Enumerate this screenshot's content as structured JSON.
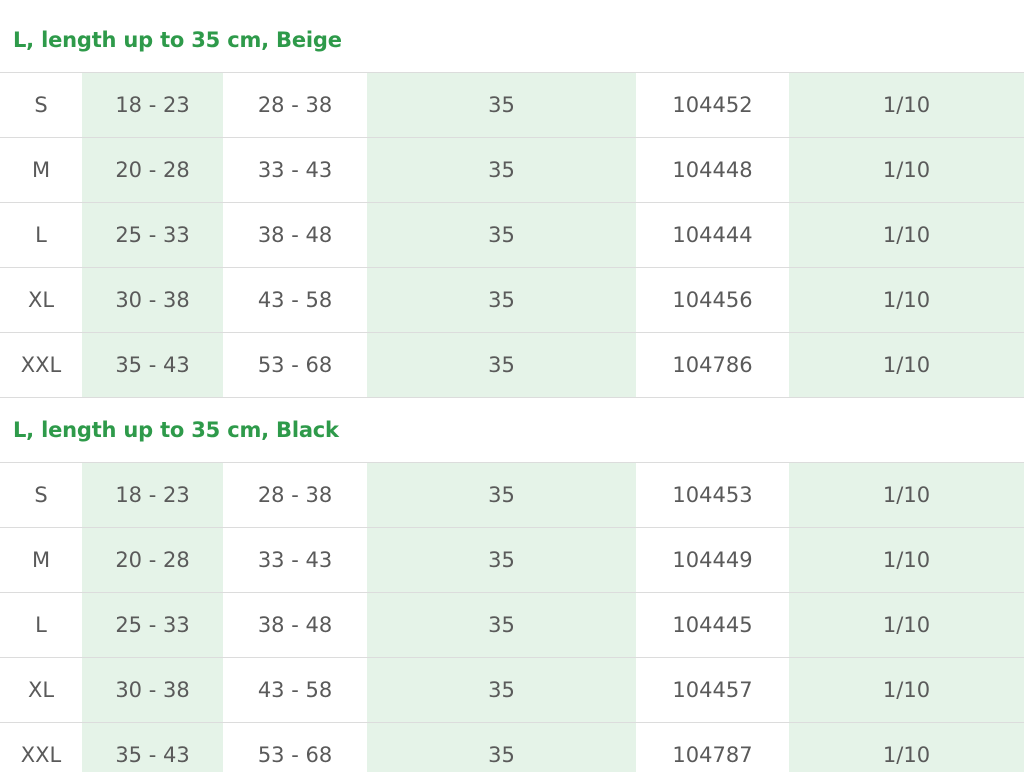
{
  "groups": [
    {
      "title": "L, length up to 35 cm, Beige",
      "rows": [
        [
          "S",
          "18 - 23",
          "28 - 38",
          "35",
          "104452",
          "1/10"
        ],
        [
          "M",
          "20 - 28",
          "33 - 43",
          "35",
          "104448",
          "1/10"
        ],
        [
          "L",
          "25 - 33",
          "38 - 48",
          "35",
          "104444",
          "1/10"
        ],
        [
          "XL",
          "30 - 38",
          "43 - 58",
          "35",
          "104456",
          "1/10"
        ],
        [
          "XXL",
          "35 - 43",
          "53 - 68",
          "35",
          "104786",
          "1/10"
        ]
      ]
    },
    {
      "title": "L, length up to 35 cm, Black",
      "rows": [
        [
          "S",
          "18 - 23",
          "28 - 38",
          "35",
          "104453",
          "1/10"
        ],
        [
          "M",
          "20 - 28",
          "33 - 43",
          "35",
          "104449",
          "1/10"
        ],
        [
          "L",
          "25 - 33",
          "38 - 48",
          "35",
          "104445",
          "1/10"
        ],
        [
          "XL",
          "30 - 38",
          "43 - 58",
          "35",
          "104457",
          "1/10"
        ],
        [
          "XXL",
          "35 - 43",
          "53 - 68",
          "35",
          "104787",
          "1/10"
        ]
      ]
    }
  ],
  "colors": {
    "title": "#2e9a4a",
    "shade": "#e5f3e8",
    "text": "#5a5a5a",
    "border": "#dcdcdc"
  }
}
